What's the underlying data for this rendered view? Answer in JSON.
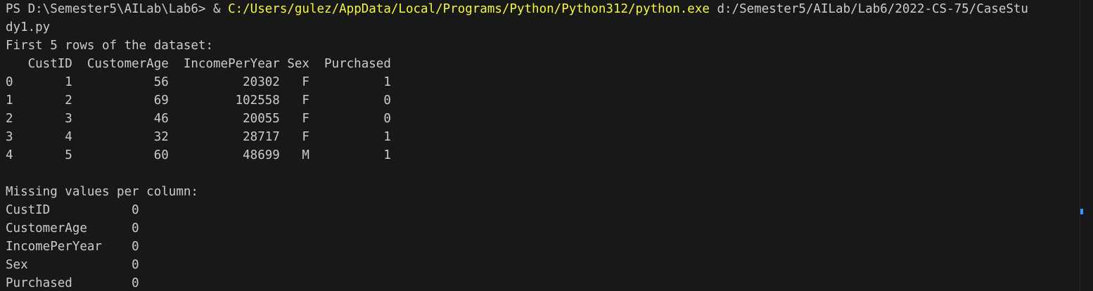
{
  "terminal": {
    "prompt": "PS D:\\Semester5\\AILab\\Lab6> & ",
    "exe_path": "C:/Users/gulez/AppData/Local/Programs/Python/Python312/python.exe",
    "script_arg_part1": " d:/Semester5/AILab/Lab6/2022-CS-75/CaseStu",
    "script_arg_part2": "dy1.py",
    "output_lines": [
      "First 5 rows of the dataset:",
      "   CustID  CustomerAge  IncomePerYear Sex  Purchased",
      "0       1           56          20302   F          1",
      "1       2           69         102558   F          0",
      "2       3           46          20055   F          0",
      "3       4           32          28717   F          1",
      "4       5           60          48699   M          1",
      "",
      "Missing values per column:",
      "CustID           0",
      "CustomerAge      0",
      "IncomePerYear    0",
      "Sex              0",
      "Purchased        0"
    ]
  },
  "colors": {
    "background": "#181818",
    "text": "#cccccc",
    "path_highlight": "#f5f543",
    "scroll_marker": "#3794ff"
  }
}
